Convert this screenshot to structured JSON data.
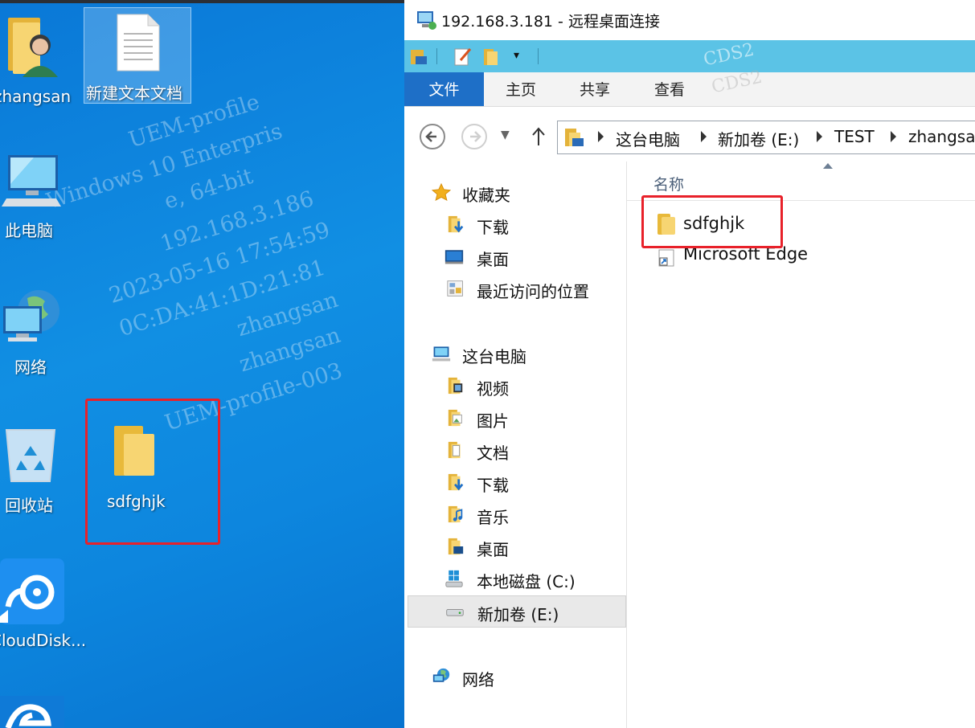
{
  "desktop": {
    "icons": [
      {
        "label": "zhangsan",
        "icon": "user-folder-icon"
      },
      {
        "label": "新建文本文档",
        "icon": "text-document-icon"
      },
      {
        "label": "此电脑",
        "icon": "computer-icon"
      },
      {
        "label": "网络",
        "icon": "network-globe-icon"
      },
      {
        "label": "回收站",
        "icon": "recycle-bin-icon"
      },
      {
        "label": "sdfghjk",
        "icon": "folder-icon"
      },
      {
        "label": "CloudDisk...",
        "icon": "cloud-disk-icon"
      },
      {
        "label": "",
        "icon": "edge-icon"
      }
    ],
    "watermark": [
      "UEM-profile",
      "Windows 10 Enterpris",
      "e, 64-bit",
      "192.168.3.186",
      "2023-05-16 17:54:59",
      "0C:DA:41:1D:21:81",
      "zhangsan",
      "zhangsan",
      "UEM-profile-003"
    ]
  },
  "remote": {
    "title": "192.168.3.181 - 远程桌面连接",
    "watermark": [
      "CDS2",
      "CDS2"
    ],
    "ribbon_tabs": [
      "文件",
      "主页",
      "共享",
      "查看"
    ],
    "breadcrumb": [
      "这台电脑",
      "新加卷 (E:)",
      "TEST",
      "zhangsa"
    ],
    "nav": {
      "favorites_label": "收藏夹",
      "favorites": [
        "下载",
        "桌面",
        "最近访问的位置"
      ],
      "pc_label": "这台电脑",
      "pc_items": [
        "视频",
        "图片",
        "文档",
        "下载",
        "音乐",
        "桌面",
        "本地磁盘 (C:)",
        "新加卷 (E:)"
      ],
      "network_label": "网络"
    },
    "column_header": "名称",
    "files": [
      {
        "name": "sdfghjk",
        "icon": "folder-icon"
      },
      {
        "name": "Microsoft Edge",
        "icon": "shortcut-icon"
      }
    ]
  },
  "colors": {
    "highlight_box": "#e8212a",
    "ribbon_file_tab": "#1e6fc7",
    "quick_access_bar": "#5bc3e6"
  }
}
